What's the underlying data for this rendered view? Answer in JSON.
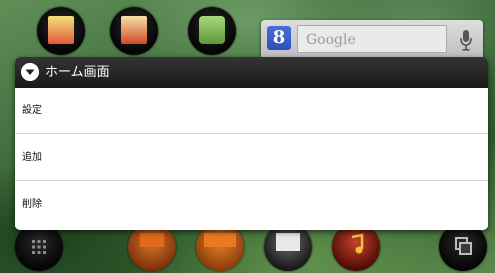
{
  "search": {
    "placeholder": "Google",
    "logo_letter": "8"
  },
  "dialog": {
    "title": "ホーム画面",
    "items": [
      {
        "label": "設定"
      },
      {
        "label": "追加"
      },
      {
        "label": "削除"
      }
    ]
  },
  "icons": {
    "top_row": [
      "app-icon-red-yellow",
      "app-icon-coupon",
      "market-icon"
    ],
    "dock": [
      "app-drawer-icon",
      "au-app-icon",
      "au-one-icon",
      "mail-icon",
      "music-icon",
      "recent-apps-icon"
    ]
  },
  "colors": {
    "dialog_header": "#222222",
    "dialog_body": "#ffffff",
    "divider": "#d8d8d8"
  }
}
